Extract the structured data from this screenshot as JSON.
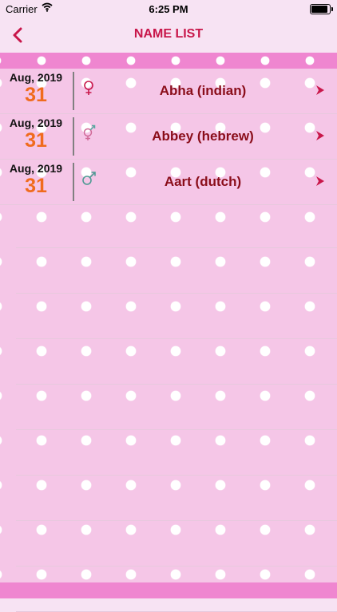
{
  "status": {
    "carrier": "Carrier",
    "time": "6:25 PM"
  },
  "navbar": {
    "title": "NAME LIST",
    "back_icon": "chevron-left-icon"
  },
  "colors": {
    "accent": "#c8174a",
    "name_text": "#8a0d1a",
    "day_text": "#f06b1d",
    "background": "#f5c6e7"
  },
  "list": {
    "items": [
      {
        "month": "Aug, 2019",
        "day": "31",
        "gender_icon": "female-icon",
        "name": "Abha (indian)"
      },
      {
        "month": "Aug, 2019",
        "day": "31",
        "gender_icon": "unisex-icon",
        "name": "Abbey (hebrew)"
      },
      {
        "month": "Aug, 2019",
        "day": "31",
        "gender_icon": "male-icon",
        "name": "Aart (dutch)"
      }
    ]
  }
}
